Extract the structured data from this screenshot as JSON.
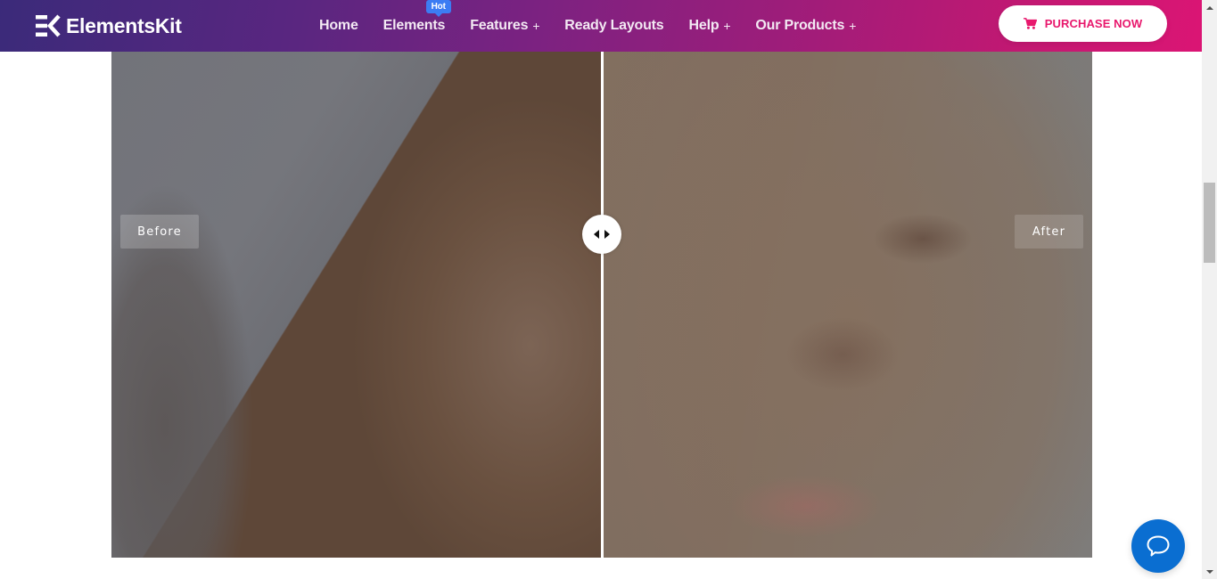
{
  "header": {
    "logo_text": "ElementsKit",
    "nav": [
      {
        "label": "Home",
        "has_submenu": false
      },
      {
        "label": "Elements",
        "has_submenu": false,
        "badge": "Hot"
      },
      {
        "label": "Features",
        "has_submenu": true
      },
      {
        "label": "Ready Layouts",
        "has_submenu": false
      },
      {
        "label": "Help",
        "has_submenu": true
      },
      {
        "label": "Our Products",
        "has_submenu": true
      }
    ],
    "submenu_indicator": "+",
    "cta": {
      "label": "PURCHASE NOW",
      "icon": "cart-icon"
    }
  },
  "comparison": {
    "before_label": "Before",
    "after_label": "After",
    "slider_position_fraction": 0.5,
    "handle_icon": "left-right-arrows-icon"
  },
  "chat": {
    "icon": "chat-bubble-icon"
  },
  "colors": {
    "header_gradient_start": "#3b2a7a",
    "header_gradient_end": "#db1574",
    "cta_text": "#e8186d",
    "hot_badge": "#3c7cf3",
    "chat_button": "#0a6ed1"
  }
}
